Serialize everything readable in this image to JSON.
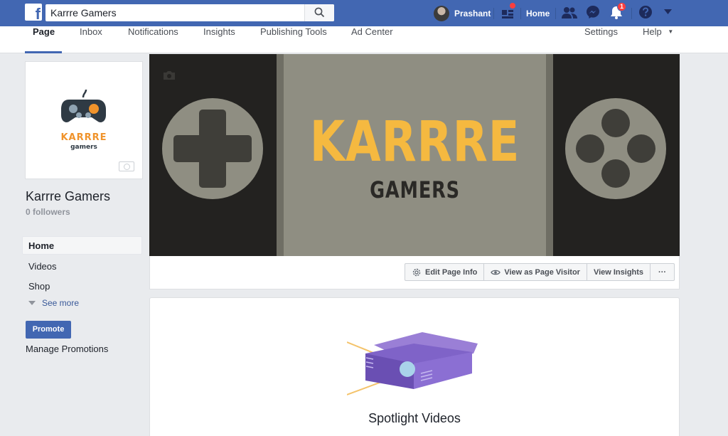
{
  "topbar": {
    "logo_letter": "f",
    "search_value": "Karrre Gamers",
    "profile_name": "Prashant",
    "home_label": "Home",
    "notifications_count": "1",
    "brand_color": "#4267b2"
  },
  "page_nav": {
    "tabs": [
      {
        "label": "Page"
      },
      {
        "label": "Inbox"
      },
      {
        "label": "Notifications"
      },
      {
        "label": "Insights"
      },
      {
        "label": "Publishing Tools"
      },
      {
        "label": "Ad Center"
      }
    ],
    "settings_label": "Settings",
    "help_label": "Help"
  },
  "page": {
    "name": "Karrre Gamers",
    "followers": "0 followers",
    "logo_text": "KARRRE",
    "logo_sub": "gamers"
  },
  "sidebar": {
    "items": [
      {
        "label": "Home"
      },
      {
        "label": "Videos"
      },
      {
        "label": "Shop"
      }
    ],
    "see_more": "See more",
    "promote": "Promote",
    "manage_promotions": "Manage Promotions"
  },
  "cover": {
    "title": "KARRRE",
    "subtitle": "GAMERS"
  },
  "actions": {
    "edit_page_info": "Edit Page Info",
    "view_as_visitor": "View as Page Visitor",
    "view_insights": "View Insights",
    "more": "···"
  },
  "spotlight": {
    "title": "Spotlight Videos"
  }
}
